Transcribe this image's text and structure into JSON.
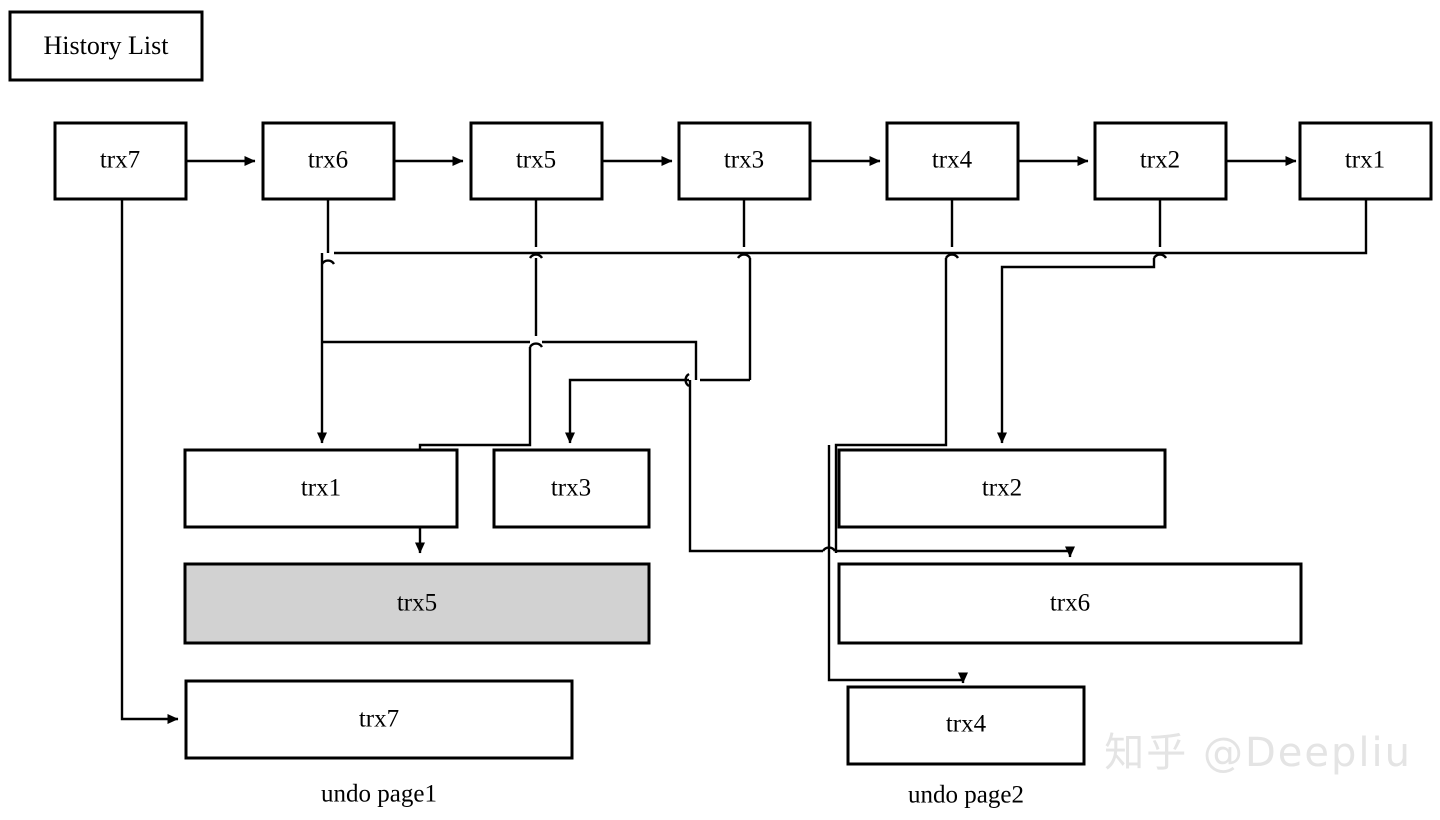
{
  "title_box": {
    "label": "History List"
  },
  "history_list": {
    "nodes": [
      {
        "label": "trx7"
      },
      {
        "label": "trx6"
      },
      {
        "label": "trx5"
      },
      {
        "label": "trx3"
      },
      {
        "label": "trx4"
      },
      {
        "label": "trx2"
      },
      {
        "label": "trx1"
      }
    ]
  },
  "undo_page1": {
    "caption": "undo page1",
    "entries": [
      {
        "label": "trx1",
        "highlighted": false
      },
      {
        "label": "trx3",
        "highlighted": false
      },
      {
        "label": "trx5",
        "highlighted": true
      },
      {
        "label": "trx7",
        "highlighted": false
      }
    ]
  },
  "undo_page2": {
    "caption": "undo page2",
    "entries": [
      {
        "label": "trx2",
        "highlighted": false
      },
      {
        "label": "trx6",
        "highlighted": false
      },
      {
        "label": "trx4",
        "highlighted": false
      }
    ]
  },
  "watermark": {
    "text": "知乎 @Deepliu"
  },
  "colors": {
    "stroke": "#000000",
    "background": "#ffffff",
    "highlight_fill": "#d2d2d2",
    "watermark": "#e4e4e4"
  }
}
